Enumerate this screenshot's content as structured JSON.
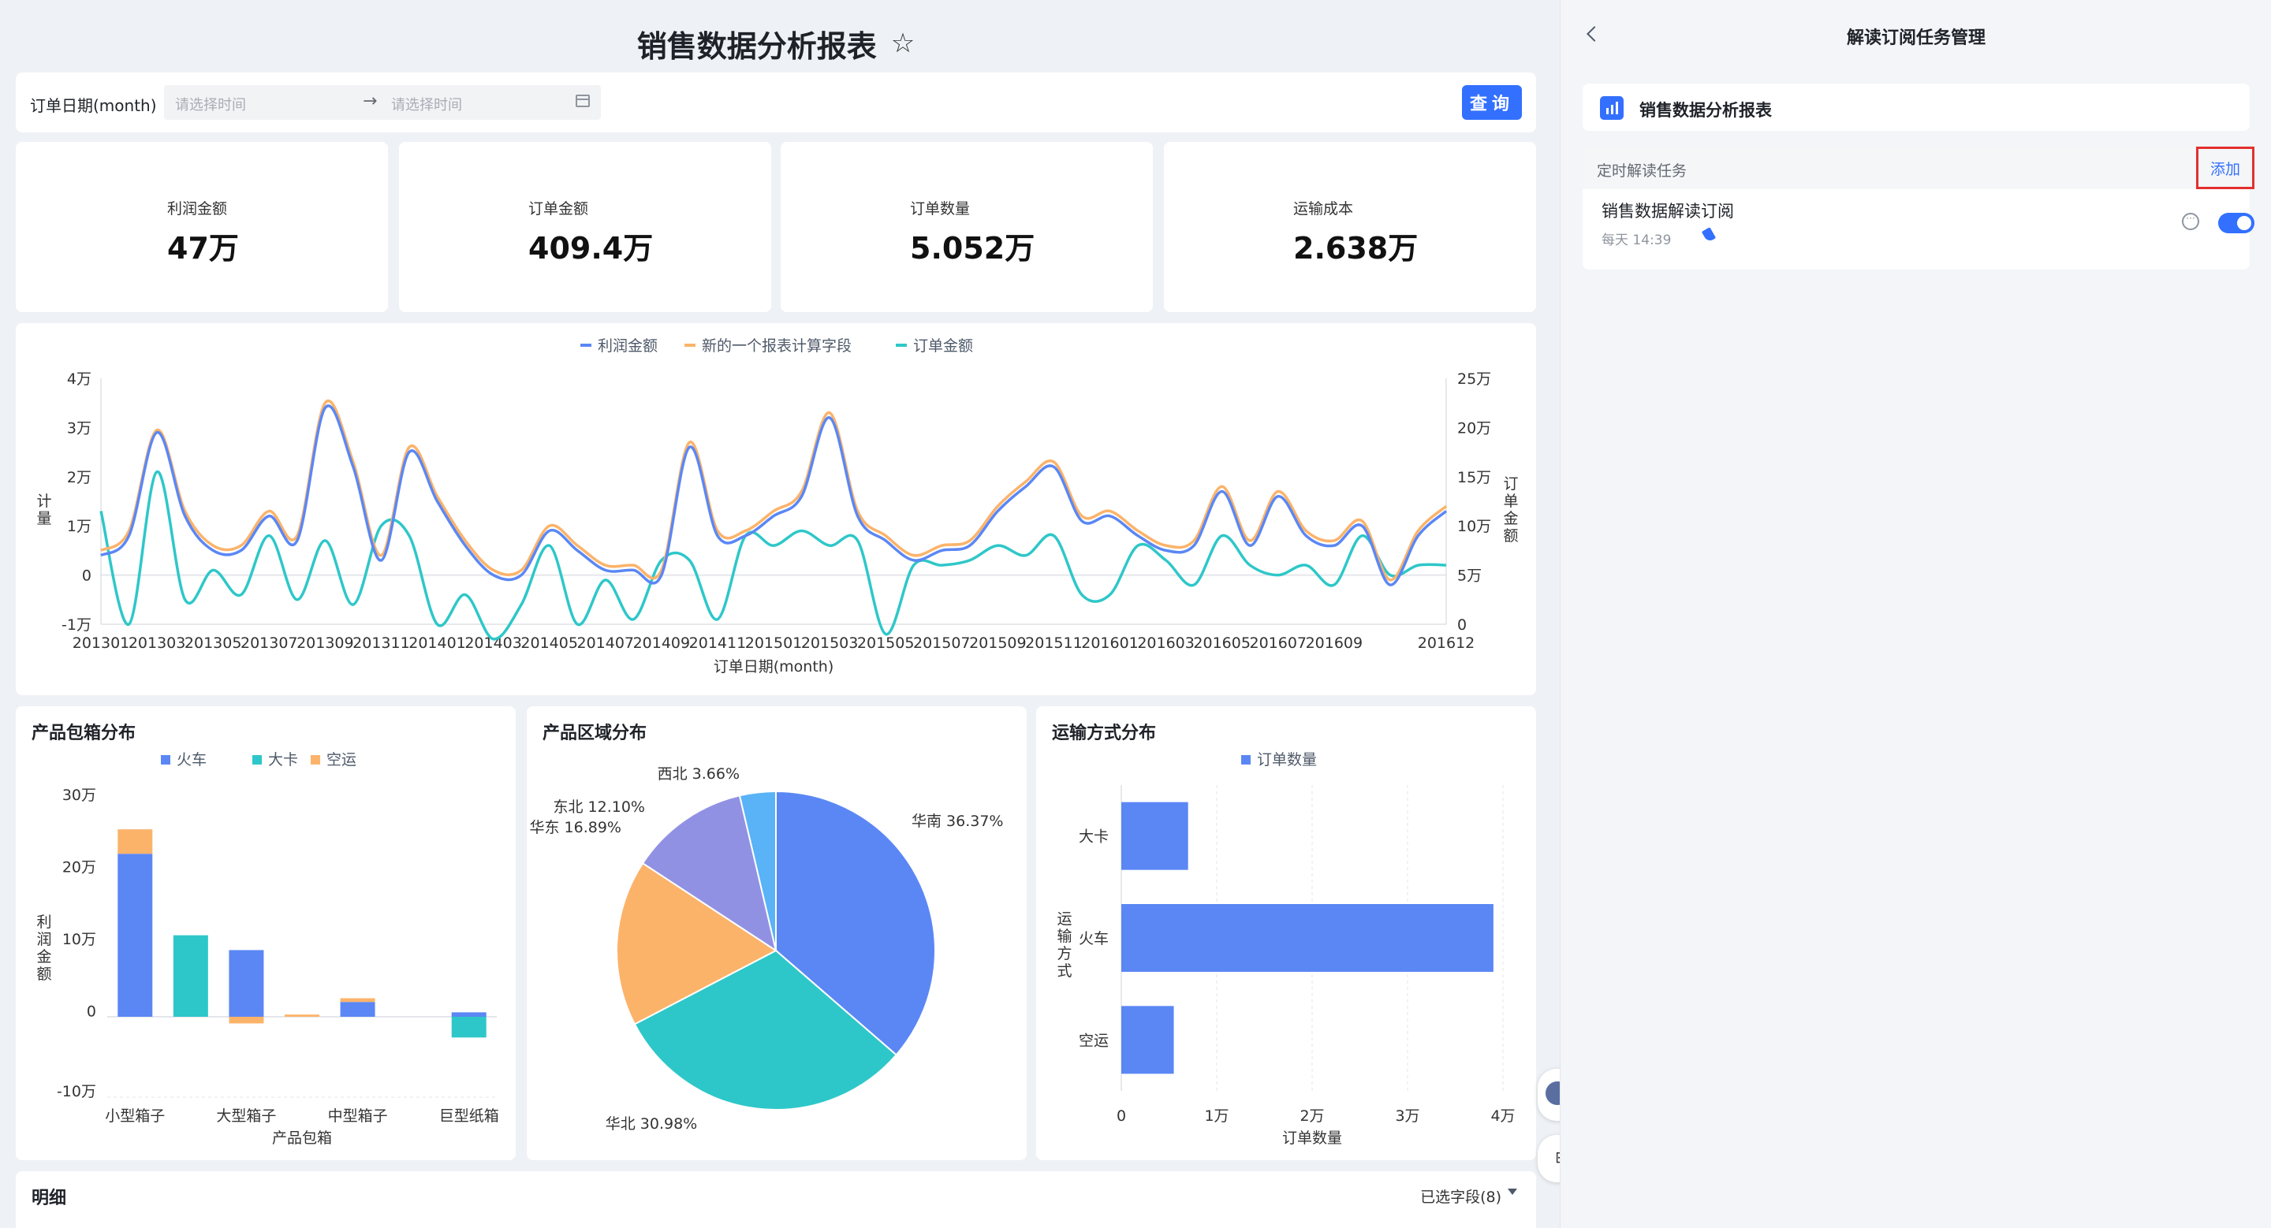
{
  "header": {
    "title": "销售数据分析报表",
    "star_icon": "star-outline-icon"
  },
  "filter": {
    "label": "订单日期(month)",
    "start_placeholder": "请选择时间",
    "end_placeholder": "请选择时间",
    "range_arrow": "→",
    "calendar_icon": "calendar-icon",
    "query_label": "查询"
  },
  "kpis": [
    {
      "label": "利润金额",
      "value": "47万"
    },
    {
      "label": "订单金额",
      "value": "409.4万"
    },
    {
      "label": "订单数量",
      "value": "5.052万"
    },
    {
      "label": "运输成本",
      "value": "2.638万"
    }
  ],
  "colors": {
    "blue": "#5b87f5",
    "orange": "#fbb36a",
    "teal": "#2ec7c9",
    "purple": "#9191e4",
    "sky": "#59b3f6",
    "accent": "#3370ff"
  },
  "chart_data": [
    {
      "type": "line",
      "legend": [
        "利润金额",
        "新的一个报表计算字段",
        "订单金额"
      ],
      "x_ticks": [
        "201301",
        "201303",
        "201305",
        "201307",
        "201309",
        "201311",
        "201401",
        "201403",
        "201405",
        "201407",
        "201409",
        "201411",
        "201501",
        "201503",
        "201505",
        "201507",
        "201509",
        "201511",
        "201601",
        "201603",
        "201605",
        "201607",
        "201609",
        "201612"
      ],
      "xlabel": "订单日期(month)",
      "ylabel_left": "计量",
      "ylabel_right": "订单金额",
      "y_left_ticks": [
        "4万",
        "3万",
        "2万",
        "1万",
        "0",
        "-1万"
      ],
      "y_left_range": [
        -10000,
        40000
      ],
      "y_right_ticks": [
        "25万",
        "20万",
        "15万",
        "10万",
        "5万",
        "0"
      ],
      "y_right_range": [
        0,
        250000
      ],
      "series": [
        {
          "name": "利润金额",
          "axis": "left",
          "values": [
            4000,
            8000,
            29000,
            12000,
            5000,
            5000,
            12000,
            7000,
            34000,
            22000,
            3000,
            25000,
            15000,
            6000,
            0,
            0,
            9000,
            5000,
            1000,
            1000,
            0,
            26000,
            8000,
            8000,
            12000,
            16000,
            32000,
            12000,
            7000,
            3000,
            5000,
            6000,
            13000,
            18000,
            22000,
            11000,
            12000,
            8000,
            5000,
            6000,
            17000,
            6000,
            16000,
            8000,
            6000,
            10000,
            -2000,
            8000,
            13000
          ]
        },
        {
          "name": "新的一个报表计算字段",
          "axis": "left",
          "values": [
            5000,
            9000,
            29500,
            13000,
            6000,
            6000,
            13000,
            8000,
            35000,
            23000,
            4000,
            26000,
            16000,
            7000,
            1000,
            1000,
            10000,
            6000,
            2000,
            2000,
            1000,
            27000,
            9000,
            9000,
            13000,
            17000,
            33000,
            13000,
            8000,
            4000,
            6000,
            7000,
            14000,
            19000,
            23000,
            12000,
            13000,
            9000,
            6000,
            7000,
            18000,
            7000,
            17000,
            9000,
            7000,
            11000,
            -1000,
            9000,
            14000
          ]
        },
        {
          "name": "订单金额",
          "axis": "right",
          "values": [
            115000,
            0,
            155000,
            25000,
            55000,
            30000,
            90000,
            25000,
            85000,
            20000,
            100000,
            90000,
            0,
            30000,
            -15000,
            20000,
            80000,
            0,
            45000,
            5000,
            65000,
            65000,
            5000,
            90000,
            80000,
            95000,
            80000,
            85000,
            -10000,
            60000,
            60000,
            65000,
            80000,
            70000,
            90000,
            30000,
            30000,
            80000,
            65000,
            40000,
            90000,
            60000,
            50000,
            60000,
            40000,
            90000,
            50000,
            60000,
            60000
          ]
        }
      ]
    },
    {
      "type": "bar",
      "title": "产品包箱分布",
      "legend": [
        "火车",
        "大卡",
        "空运"
      ],
      "categories": [
        "小型箱子",
        "",
        "大型箱子",
        "",
        "中型箱子",
        "",
        "巨型纸箱"
      ],
      "x_tick_labels": [
        "小型箱子",
        "大型箱子",
        "中型箱子",
        "巨型纸箱"
      ],
      "xlabel": "产品包箱",
      "ylabel": "利润金额",
      "y_ticks": [
        "30万",
        "20万",
        "10万",
        "0",
        "-10万"
      ],
      "ylim": [
        -100000,
        300000
      ],
      "series": [
        {
          "name": "火车",
          "values": [
            220000,
            0,
            90000,
            0,
            20000,
            0,
            6000
          ]
        },
        {
          "name": "大卡",
          "values": [
            0,
            110000,
            0,
            0,
            0,
            0,
            -28000
          ]
        },
        {
          "name": "空运",
          "values": [
            33000,
            0,
            -9000,
            3000,
            5000,
            0,
            0
          ]
        }
      ]
    },
    {
      "type": "pie",
      "title": "产品区域分布",
      "slices": [
        {
          "name": "华南",
          "value": 36.37,
          "label": "华南 36.37%"
        },
        {
          "name": "华北",
          "value": 30.98,
          "label": "华北 30.98%"
        },
        {
          "name": "华东",
          "value": 16.89,
          "label": "华东 16.89%"
        },
        {
          "name": "东北",
          "value": 12.1,
          "label": "东北 12.10%"
        },
        {
          "name": "西北",
          "value": 3.66,
          "label": "西北 3.66%"
        }
      ]
    },
    {
      "type": "bar",
      "orientation": "horizontal",
      "title": "运输方式分布",
      "legend": [
        "订单数量"
      ],
      "categories": [
        "大卡",
        "火车",
        "空运"
      ],
      "values": [
        7000,
        39000,
        5500
      ],
      "xlabel": "订单数量",
      "ylabel": "运输方式",
      "x_ticks": [
        "0",
        "1万",
        "2万",
        "3万",
        "4万"
      ],
      "xlim": [
        0,
        40000
      ]
    }
  ],
  "detail": {
    "title": "明细",
    "fields_label": "已选字段(8)"
  },
  "side_panel": {
    "title": "解读订阅任务管理",
    "report_name": "销售数据分析报表",
    "section_label": "定时解读任务",
    "add_label": "添加",
    "task_name": "销售数据解读订阅",
    "task_schedule": "每天 14:39"
  }
}
